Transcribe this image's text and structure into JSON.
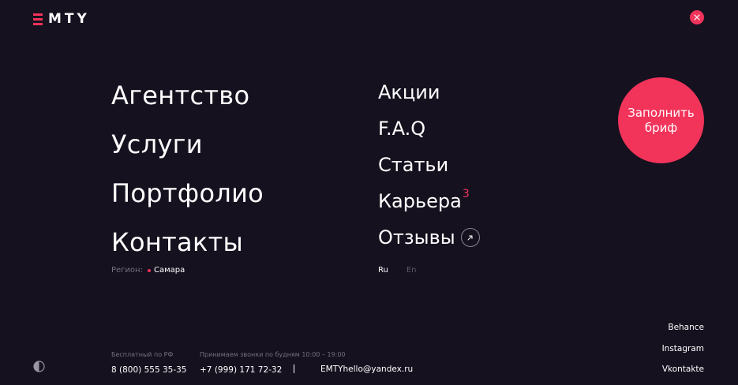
{
  "header": {
    "logo_text": "MTY",
    "close_label": ""
  },
  "nav_main": [
    {
      "label": "Агентство"
    },
    {
      "label": "Услуги"
    },
    {
      "label": "Портфолио"
    },
    {
      "label": "Контакты"
    }
  ],
  "nav_secondary": [
    {
      "label": "Акции"
    },
    {
      "label": "F.A.Q"
    },
    {
      "label": "Статьи"
    },
    {
      "label": "Карьера",
      "badge": "3"
    },
    {
      "label": "Отзывы"
    }
  ],
  "region": {
    "label": "Регион:",
    "value": "Самара"
  },
  "languages": {
    "ru": "Ru",
    "en": "En",
    "active": "Ru"
  },
  "brief_button": {
    "label": "Заполнить бриф"
  },
  "contacts": {
    "free_caption": "Бесплатный по РФ",
    "free_phone": "8 (800) 555 35-35",
    "calls_caption": "Принимаем звонки по будням 10:00 – 19:00",
    "mobile_phone": "+7 (999) 171 72-32",
    "email": "EMTYhello@yandex.ru"
  },
  "socials": [
    {
      "label": "Behance"
    },
    {
      "label": "Instagram"
    },
    {
      "label": "Vkontakte"
    }
  ],
  "colors": {
    "background": "#15111f",
    "accent": "#f2335a",
    "text": "#ffffff",
    "muted": "#77717f"
  },
  "icons": {
    "close": "close-icon",
    "arrow": "arrow-up-right-icon",
    "theme": "theme-toggle-icon"
  }
}
